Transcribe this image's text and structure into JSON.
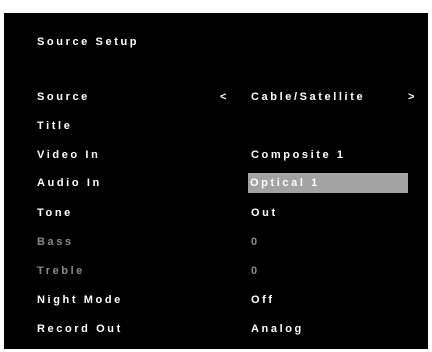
{
  "menu": {
    "title": "Source Setup",
    "rows": [
      {
        "label": "Source",
        "value": "Cable/Satellite",
        "prev_arrow": "<",
        "next_arrow": ">"
      },
      {
        "label": "Title",
        "value": ""
      },
      {
        "label": "Video In",
        "value": "Composite 1"
      },
      {
        "label": "Audio In",
        "value": "Optical 1",
        "selected": true
      },
      {
        "label": "Tone",
        "value": "Out"
      },
      {
        "label": "Bass",
        "value": "0",
        "disabled": true
      },
      {
        "label": "Treble",
        "value": "0",
        "disabled": true
      },
      {
        "label": "Night Mode",
        "value": "Off"
      },
      {
        "label": "Record Out",
        "value": "Analog"
      }
    ]
  },
  "colors": {
    "background": "#000000",
    "text": "#ffffff",
    "disabled_text": "#8a8a8a",
    "highlight": "#a3a3a3"
  }
}
